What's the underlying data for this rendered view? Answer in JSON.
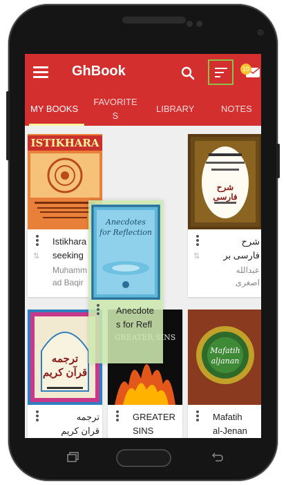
{
  "app": {
    "title": "GhBook",
    "notification_count": "10",
    "accent_color": "#d32f2f",
    "highlight_color": "#8bc34a"
  },
  "tabs": [
    {
      "label": "MY BOOKS",
      "active": true
    },
    {
      "label": "FAVORITES",
      "active": false
    },
    {
      "label": "LIBRARY",
      "active": false
    },
    {
      "label": "NOTES",
      "active": false
    }
  ],
  "tab_labels": {
    "my_books": "MY BOOKS",
    "favorites_line1": "FAVORITE",
    "favorites_line2": "S",
    "library": "LIBRARY",
    "notes": "NOTES"
  },
  "books": {
    "b1": {
      "title_line1": "Istikhara",
      "title_line2": "seeking",
      "author_line1": "Muhamm",
      "author_line2": "ad Baqir",
      "cover_title": "ISTIKHARA"
    },
    "b2": {
      "title_line1": "شرح",
      "title_line2": "فارسی بر",
      "author_line1": "عبدالله",
      "author_line2": "اصغری",
      "cover_title": "شرح فارسی"
    },
    "b3": {
      "title_line1": "ترجمه",
      "title_line2": "قران کریم",
      "cover_title": "ترجمه قرآن کریم"
    },
    "b4": {
      "title_line1": "GREATER",
      "title_line2": "SINS",
      "cover_title": "GREATER SINS"
    },
    "b5": {
      "title_line1": "Mafatih",
      "title_line2": "al-Jenan",
      "cover_title": "Mafatih aljanan"
    },
    "dragged": {
      "title_line1": "Anecdote",
      "title_line2": "s for Refl",
      "cover_title_line1": "Anecdotes",
      "cover_title_line2": "for Reflection"
    }
  }
}
